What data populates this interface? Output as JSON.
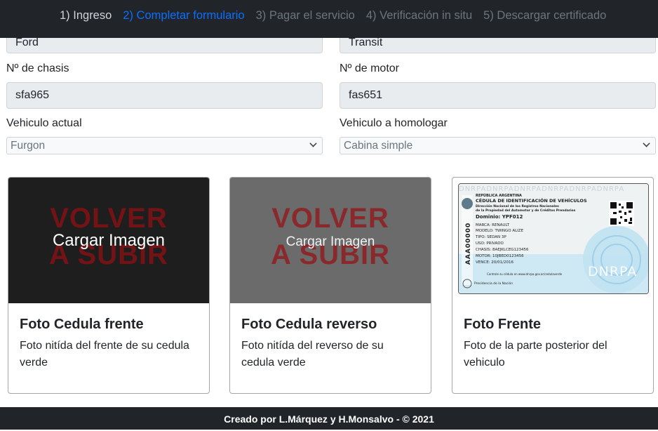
{
  "steps": [
    {
      "label": "1) Ingreso",
      "state": "done"
    },
    {
      "label": "2) Completar formulario",
      "state": "active"
    },
    {
      "label": "3) Pagar el servicio",
      "state": "pending"
    },
    {
      "label": "4) Verificación in situ",
      "state": "pending"
    },
    {
      "label": "5) Descargar certificado",
      "state": "pending"
    }
  ],
  "form": {
    "marca_value": "Ford",
    "modelo_value": "Transit",
    "chasis_label": "Nº de chasis",
    "chasis_value": "sfa965",
    "motor_label": "Nº de motor",
    "motor_value": "fas651",
    "vehiculo_actual_label": "Vehiculo actual",
    "vehiculo_actual_value": "Furgon",
    "vehiculo_homologar_label": "Vehiculo a homologar",
    "vehiculo_homologar_value": "Cabina simple"
  },
  "cards": [
    {
      "overlay_line1": "VOLVER",
      "overlay_line2": "A SUBIR",
      "upload_label": "Cargar Imagen",
      "title": "Foto Cedula frente",
      "text": "Foto nitída del frente de su cedula verde"
    },
    {
      "overlay_line1": "VOLVER",
      "overlay_line2": "A SUBIR",
      "upload_label": "Cargar Imagen",
      "title": "Foto Cedula reverso",
      "text": "Foto nitída del reverso de su cedula verde"
    },
    {
      "title": "Foto Frente",
      "text": "Foto de la parte posterior del vehiculo",
      "id_card": {
        "country": "REPÚBLICA ARGENTINA",
        "heading": "CÉDULA DE IDENTIFICACIÓN DE VEHÍCULOS",
        "sub1": "Dirección Nacional de los Registros Nacionales",
        "sub2": "de la Propiedad del Automotor y de Créditos Prendarios",
        "dominio": "Dominio: YPF012",
        "marca": "MARCA: RENAULT",
        "modelo": "MODELO: TWINGO ALIZE",
        "tipo": "TIPO: SEDAN 3P",
        "uso": "USO: PRIVADO",
        "chasis": "CHASIS: 8AEJKLCEG123456",
        "motor": "MOTOR: 10JBED0123456",
        "vence": "VENCE: 20/01/2016",
        "serial": "AAA00000",
        "consult": "Controle su cédula en www.dnrpa.gov.ar/cedulaverde",
        "presidencia": "Presidencia de la Nación",
        "brand": "DNRPA",
        "bg_text": "DNRPADNRPADNRPADNRPADNRPADNRPA"
      }
    }
  ],
  "footer": "Creado por L.Márquez y H.Monsalvo - © 2021",
  "colors": {
    "nav_bg": "#212529",
    "active_step": "#0d6efd",
    "input_bg": "#e9ecef",
    "overlay_red": "#960f14"
  }
}
